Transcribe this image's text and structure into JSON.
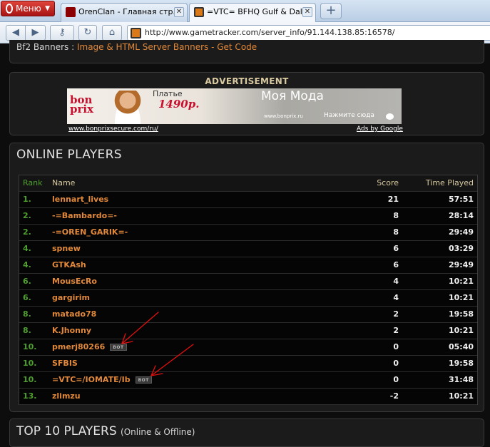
{
  "browser": {
    "menu_label": "Меню",
    "tabs": [
      {
        "title": "OrenClan - Главная стр..."
      },
      {
        "title": "=VTC= BFHQ Gulf & Dali..."
      }
    ],
    "url": "http://www.gametracker.com/server_info/91.144.138.85:16578/"
  },
  "banners": {
    "label": "Bf2 Banners :",
    "link": "Image & HTML Server Banners - Get Code"
  },
  "ad": {
    "title": "ADVERTISEMENT",
    "brand": "bon prix",
    "dress_text": "Платье",
    "price": "1490р.",
    "fashion_text": "Моя Мода",
    "site_text": "www.bonprix.ru",
    "click_text": "Нажмите сюда",
    "display_url": "www.bonprixsecure.com/ru/",
    "ads_by": "Ads by Google"
  },
  "online_players": {
    "title": "ONLINE PLAYERS",
    "headers": {
      "rank": "Rank",
      "name": "Name",
      "score": "Score",
      "time": "Time Played"
    },
    "rows": [
      {
        "rank": "1.",
        "name": "lennart_lives",
        "score": "21",
        "time": "57:51",
        "bot": ""
      },
      {
        "rank": "2.",
        "name": "-=Bambardo=-",
        "score": "8",
        "time": "28:14",
        "bot": ""
      },
      {
        "rank": "2.",
        "name": "-=OREN_GARIK=-",
        "score": "8",
        "time": "29:49",
        "bot": ""
      },
      {
        "rank": "4.",
        "name": "spnew",
        "score": "6",
        "time": "03:29",
        "bot": ""
      },
      {
        "rank": "4.",
        "name": "GTKAsh",
        "score": "6",
        "time": "29:49",
        "bot": ""
      },
      {
        "rank": "6.",
        "name": "MousEcRo",
        "score": "4",
        "time": "10:21",
        "bot": ""
      },
      {
        "rank": "6.",
        "name": "gargirim",
        "score": "4",
        "time": "10:21",
        "bot": ""
      },
      {
        "rank": "8.",
        "name": "matado78",
        "score": "2",
        "time": "19:58",
        "bot": ""
      },
      {
        "rank": "8.",
        "name": "K.Jhonny",
        "score": "2",
        "time": "10:21",
        "bot": ""
      },
      {
        "rank": "10.",
        "name": "pmerj80266",
        "score": "0",
        "time": "05:40",
        "bot": "BOT"
      },
      {
        "rank": "10.",
        "name": "SFBIS",
        "score": "0",
        "time": "19:58",
        "bot": ""
      },
      {
        "rank": "10.",
        "name": "=VTC=/IOMATE/Ib",
        "score": "0",
        "time": "31:48",
        "bot": "BOT"
      },
      {
        "rank": "13.",
        "name": "zlimzu",
        "score": "-2",
        "time": "10:21",
        "bot": ""
      }
    ]
  },
  "top10": {
    "title": "TOP 10 PLAYERS",
    "subtitle": "(Online & Offline)"
  },
  "colors": {
    "accent_orange": "#e1883a",
    "rank_green": "#4e9f2f",
    "annotation_red": "#e01010",
    "opera_red": "#c41c1c"
  }
}
